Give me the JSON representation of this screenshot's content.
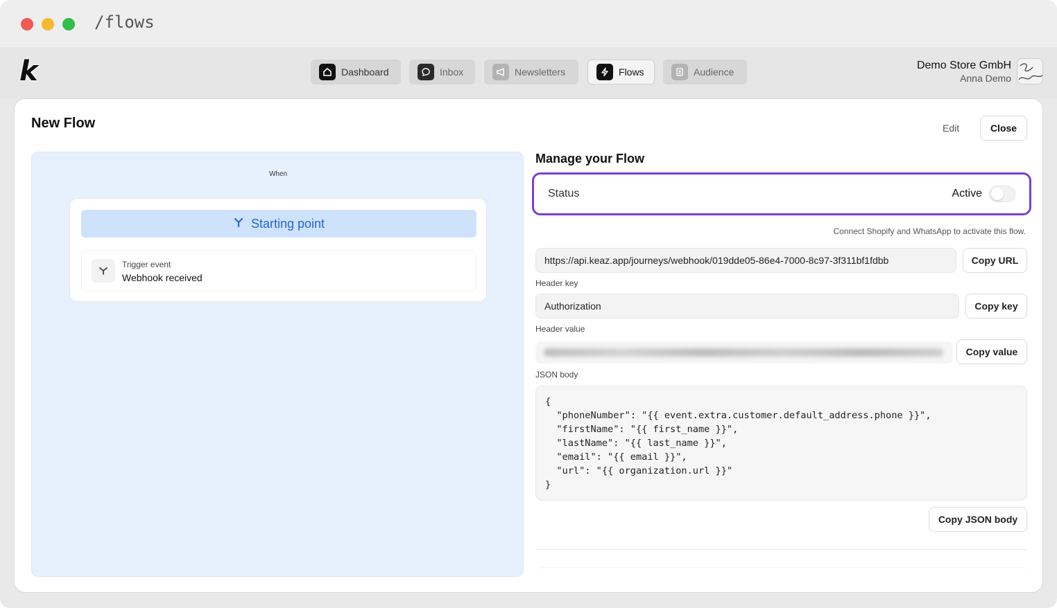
{
  "browser": {
    "url_path": "/flows"
  },
  "brand": {
    "logo_letter": "k"
  },
  "nav": [
    {
      "label": "Dashboard",
      "icon": "home-icon"
    },
    {
      "label": "Inbox",
      "icon": "chat-icon"
    },
    {
      "label": "Newsletters",
      "icon": "megaphone-icon"
    },
    {
      "label": "Flows",
      "icon": "lightning-icon"
    },
    {
      "label": "Audience",
      "icon": "contacts-icon"
    }
  ],
  "account": {
    "store": "Demo Store GmbH",
    "user": "Anna Demo"
  },
  "page": {
    "title": "New Flow",
    "edit_label": "Edit",
    "close_label": "Close"
  },
  "canvas": {
    "when_label": "When",
    "start_label": "Starting point",
    "trigger_caption": "Trigger event",
    "trigger_value": "Webhook received"
  },
  "manage": {
    "title": "Manage your Flow",
    "status_label": "Status",
    "status_value": "Active",
    "hint": "Connect Shopify and WhatsApp to activate this flow.",
    "webhook_url": "https://api.keaz.app/journeys/webhook/019dde05-86e4-7000-8c97-3f311bf1fdbb",
    "copy_url": "Copy URL",
    "header_key_label": "Header key",
    "header_key_value": "Authorization",
    "copy_key": "Copy key",
    "header_value_label": "Header value",
    "copy_value": "Copy value",
    "json_label": "JSON body",
    "json_body": "{\n  \"phoneNumber\": \"{{ event.extra.customer.default_address.phone }}\",\n  \"firstName\": \"{{ first_name }}\",\n  \"lastName\": \"{{ last_name }}\",\n  \"email\": \"{{ email }}\",\n  \"url\": \"{{ organization.url }}\"\n}",
    "copy_json": "Copy JSON body"
  },
  "colors": {
    "accent_purple": "#7a3fd3",
    "start_blue": "#1f67d8",
    "canvas_bg": "#e7f1fd"
  }
}
